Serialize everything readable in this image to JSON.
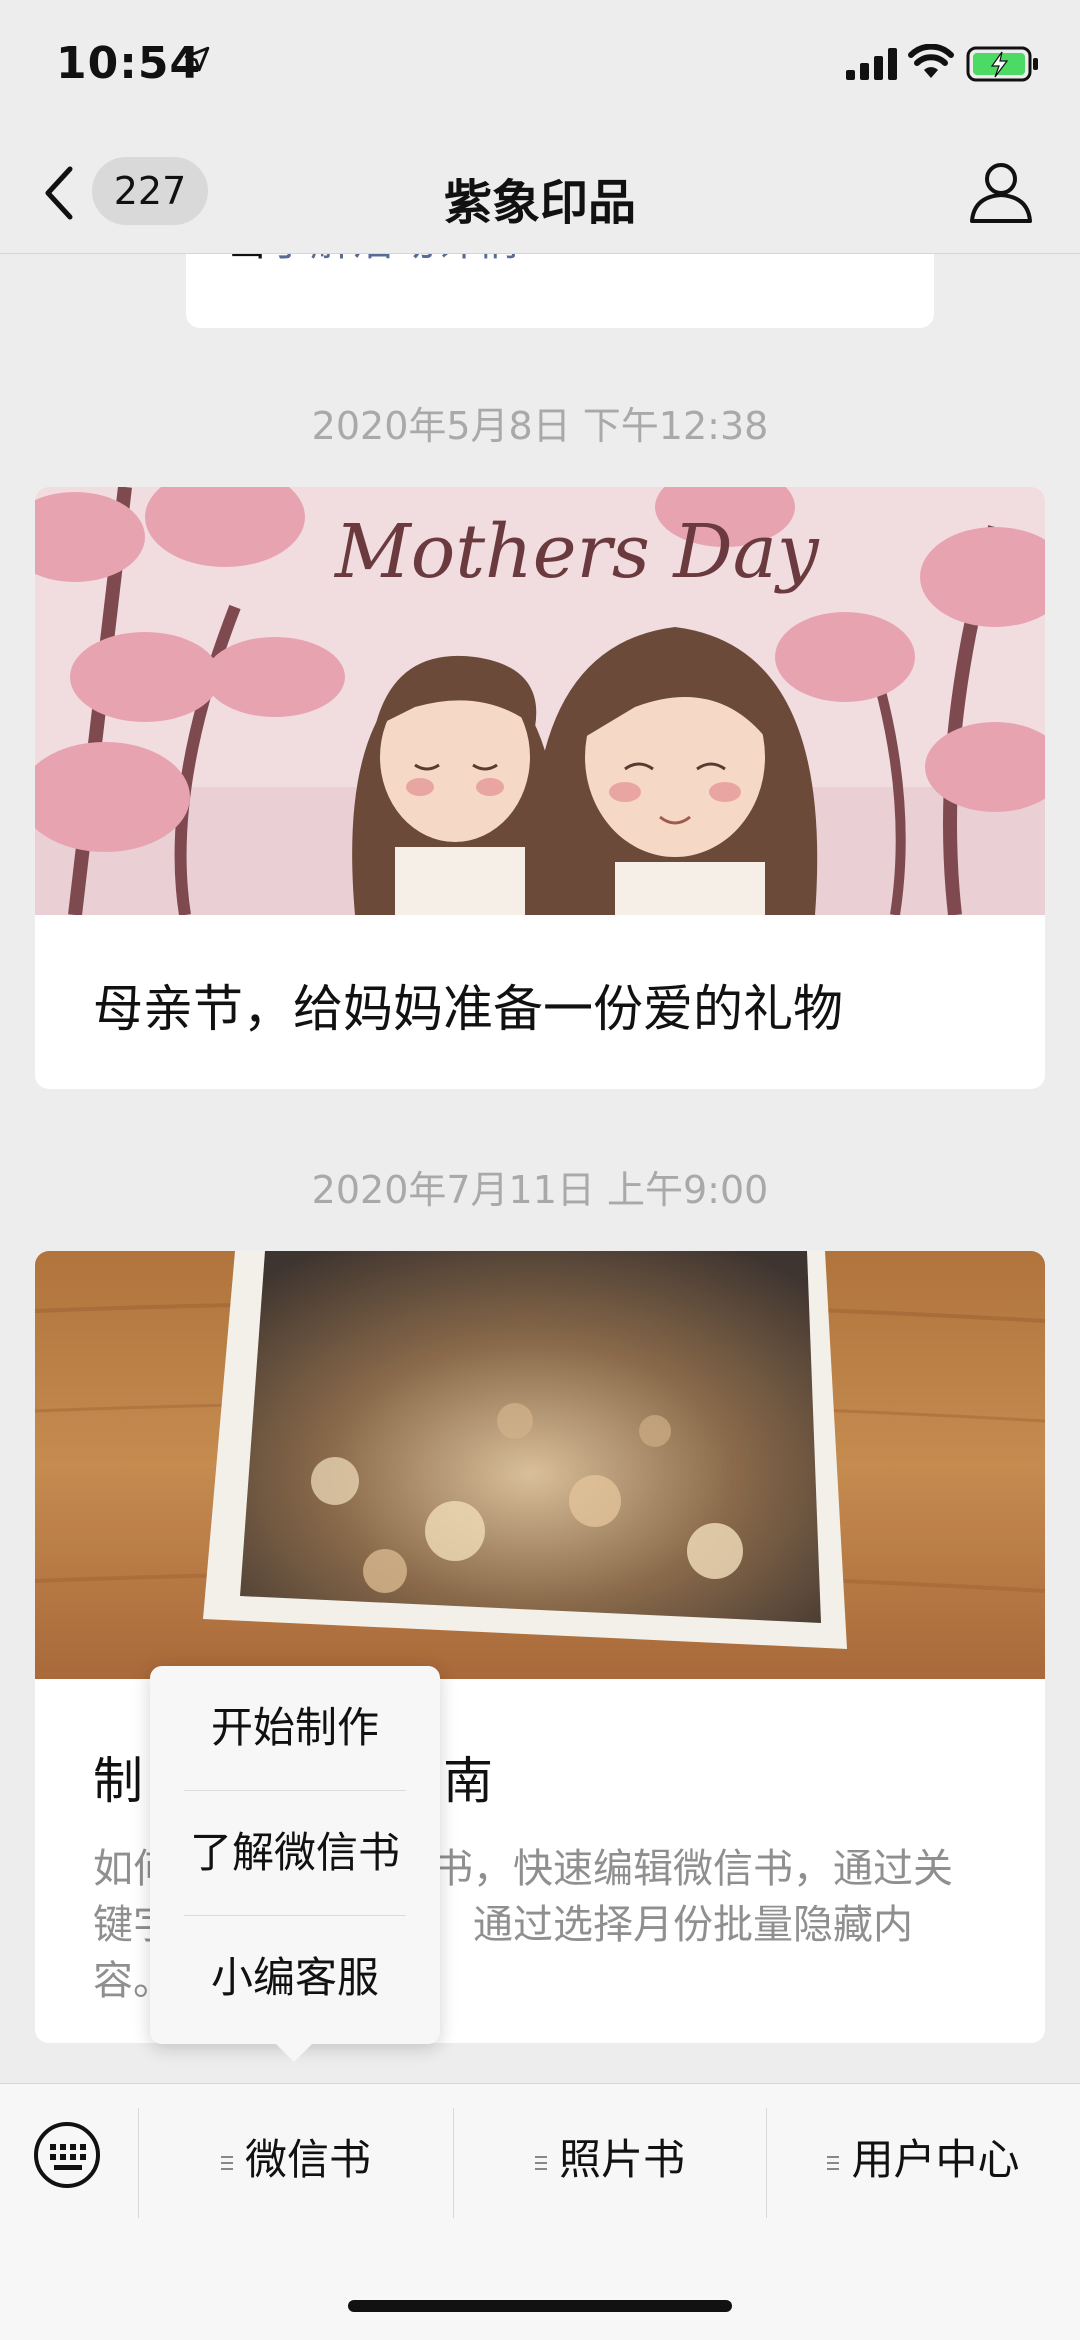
{
  "status_bar": {
    "time": "10:54"
  },
  "nav": {
    "back_count": "227",
    "title": "紫象印品"
  },
  "prev_card": {
    "text_prefix": "击",
    "link_text": "了解活动详情"
  },
  "messages": [
    {
      "timestamp": "2020年5月8日 下午12:38",
      "title": "母亲节，给妈妈准备一份爱的礼物",
      "image_text": "Mothers Day"
    },
    {
      "timestamp": "2020年7月11日 上午9:00",
      "title_left": "制",
      "title_right": "南",
      "desc_line1_left": "如何",
      "desc_line1_right": "书，快速编辑微信书，通过关",
      "desc_line2_left": "键字",
      "desc_line2_right": "通过选择月份批量隐藏内",
      "desc_line3_left": "容。"
    }
  ],
  "popup_menu": {
    "items": [
      "开始制作",
      "了解微信书",
      "小编客服"
    ]
  },
  "bottom_menu": {
    "tabs": [
      "微信书",
      "照片书",
      "用户中心"
    ]
  },
  "icons": [
    "location-arrow-icon",
    "signal-icon",
    "wifi-icon",
    "battery-charging-icon",
    "back-chevron-icon",
    "user-profile-icon",
    "keyboard-icon",
    "menu-lines-icon"
  ],
  "colors": {
    "link": "#576b95",
    "background": "#ededed",
    "battery": "#4cd964"
  }
}
